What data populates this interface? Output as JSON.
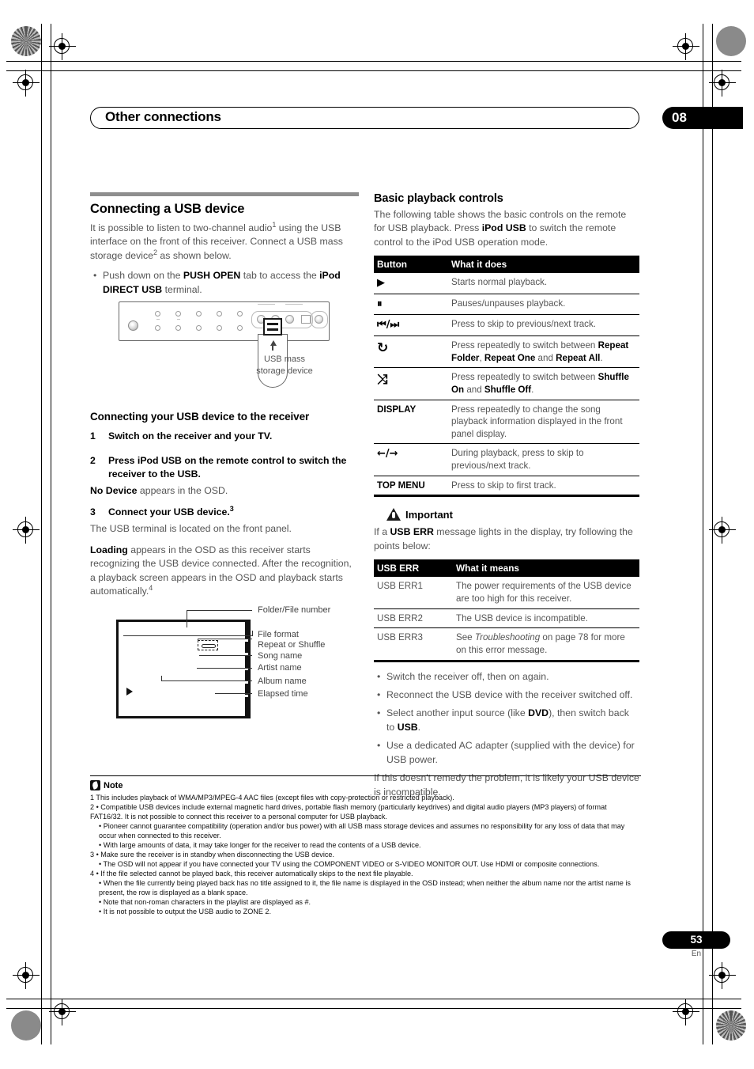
{
  "header": {
    "chapter_title": "Other connections",
    "chapter_number": "08"
  },
  "footer": {
    "page_number": "53",
    "language": "En"
  },
  "left_column": {
    "section_title": "Connecting a USB device",
    "intro_p1_a": "It is possible to listen to two-channel audio",
    "intro_p1_sup": "1",
    "intro_p1_b": " using the USB interface on the front of this receiver. Connect a USB mass storage device",
    "intro_p1_sup2": "2",
    "intro_p1_c": " as shown below.",
    "bullet_a": "Push down on the ",
    "bullet_bold1": "PUSH OPEN",
    "bullet_b": " tab to access the ",
    "bullet_bold2": "iPod DIRECT USB",
    "bullet_c": " terminal.",
    "panel_caption": "USB mass\nstorage device",
    "subsection_title": "Connecting your USB device to the receiver",
    "steps": [
      {
        "num": "1",
        "text": "Switch on the receiver and your TV.",
        "follow_bold": "",
        "follow_text": ""
      },
      {
        "num": "2",
        "text": "Press iPod USB on the remote control to switch the receiver to the USB.",
        "follow_bold": "No Device",
        "follow_text": " appears in the OSD."
      },
      {
        "num": "3",
        "text": "Connect your USB device.",
        "sup": "3",
        "follow_bold": "",
        "follow_text": "The USB terminal is located on the front panel."
      }
    ],
    "loading_bold": "Loading",
    "loading_text": " appears in the OSD as this receiver starts recognizing the USB device connected. After the recognition, a playback screen appears in the OSD and playback starts automatically.",
    "loading_sup": "4",
    "osd_labels": [
      "Folder/File number",
      "File format",
      "Repeat or Shuffle",
      "Song name",
      "Artist name",
      "Album name",
      "Elapsed time"
    ]
  },
  "right_column": {
    "section_title": "Basic playback controls",
    "intro_a": "The following table shows the basic controls on the remote for USB playback. Press ",
    "intro_bold": "iPod USB",
    "intro_b": " to switch the remote control to the iPod USB operation mode.",
    "controls_table": {
      "headers": [
        "Button",
        "What it does"
      ],
      "rows": [
        {
          "button": "▶",
          "icon_name": "play-icon",
          "desc": "Starts normal playback."
        },
        {
          "button": "⏸",
          "icon_name": "pause-icon",
          "desc": "Pauses/unpauses playback."
        },
        {
          "button": "⏮/⏭",
          "icon_name": "skip-prev-next-icon",
          "desc": "Press to skip to previous/next track."
        },
        {
          "button": "↻",
          "icon_name": "repeat-icon",
          "desc_a": "Press repeatedly to switch between ",
          "desc_b1": "Repeat Folder",
          "desc_mid": ", ",
          "desc_b2": "Repeat One",
          "desc_mid2": " and ",
          "desc_b3": "Repeat All",
          "desc_end": "."
        },
        {
          "button": "⤨",
          "icon_name": "shuffle-icon",
          "desc_a": "Press repeatedly to switch between ",
          "desc_b1": "Shuffle On",
          "desc_mid": " and ",
          "desc_b2": "Shuffle Off",
          "desc_end": "."
        },
        {
          "button": "DISPLAY",
          "icon_name": "display-label",
          "desc": "Press repeatedly to change the song playback information displayed in the front panel display."
        },
        {
          "button": "←/→",
          "icon_name": "left-right-arrow-icon",
          "desc": "During playback, press to skip to previous/next track."
        },
        {
          "button": "TOP MENU",
          "icon_name": "top-menu-label",
          "desc": "Press to skip to first track."
        }
      ]
    },
    "important_heading": "Important",
    "important_a": "If a ",
    "important_bold": "USB ERR",
    "important_b": " message lights in the display, try following the points below:",
    "err_table": {
      "headers": [
        "USB ERR",
        "What it means"
      ],
      "rows": [
        {
          "code": "USB ERR1",
          "meaning": "The power requirements of the USB device are too high for this receiver."
        },
        {
          "code": "USB ERR2",
          "meaning": "The USB device is incompatible."
        },
        {
          "code": "USB ERR3",
          "meaning_a": "See ",
          "meaning_italic": "Troubleshooting",
          "meaning_b": " on page 78 for more on this error message."
        }
      ]
    },
    "tips": [
      {
        "a": "Switch the receiver off, then on again."
      },
      {
        "a": "Reconnect the USB device with the receiver switched off."
      },
      {
        "a": "Select another input source (like ",
        "b1": "DVD",
        "mid": "), then switch back to ",
        "b2": "USB",
        "end": "."
      },
      {
        "a": "Use a dedicated AC adapter (supplied with the device) for USB power."
      }
    ],
    "closing": "If this doesn't remedy the problem, it is likely your USB device is incompatible."
  },
  "notes": {
    "heading": "Note",
    "lines": [
      {
        "indent": false,
        "text": "1 This includes playback of WMA/MP3/MPEG-4 AAC files (except files with copy-protection or restricted playback)."
      },
      {
        "indent": false,
        "text": "2 • Compatible USB devices include external magnetic hard drives, portable flash memory (particularly keydrives) and digital audio players (MP3 players) of format FAT16/32. It is not possible to connect this receiver to a personal computer for USB playback."
      },
      {
        "indent": true,
        "text": "• Pioneer cannot guarantee compatibility (operation and/or bus power) with all USB mass storage devices and assumes no responsibility for any loss of data that may occur when connected to this receiver."
      },
      {
        "indent": true,
        "text": "• With large amounts of data, it may take longer for the receiver to read the contents of a USB device."
      },
      {
        "indent": false,
        "text": "3 • Make sure the receiver is in standby when disconnecting the USB device."
      },
      {
        "indent": true,
        "text": "• The OSD will not appear if you have connected your TV using the COMPONENT VIDEO or S-VIDEO MONITOR OUT. Use HDMI or composite connections."
      },
      {
        "indent": false,
        "text": "4 • If the file selected cannot be played back, this receiver automatically skips to the next file playable."
      },
      {
        "indent": true,
        "text": "• When the file currently being played back has no title assigned to it, the file name is displayed in the OSD instead; when neither the album name nor the artist name is present, the row is displayed as a blank space."
      },
      {
        "indent": true,
        "text": "• Note that non-roman characters in the playlist are displayed as #."
      },
      {
        "indent": true,
        "text": "• It is not possible to output the USB audio to ZONE 2."
      }
    ]
  },
  "colors": {
    "accent": "#000000",
    "body_text": "#555555",
    "rule": "#8e8e8e"
  }
}
